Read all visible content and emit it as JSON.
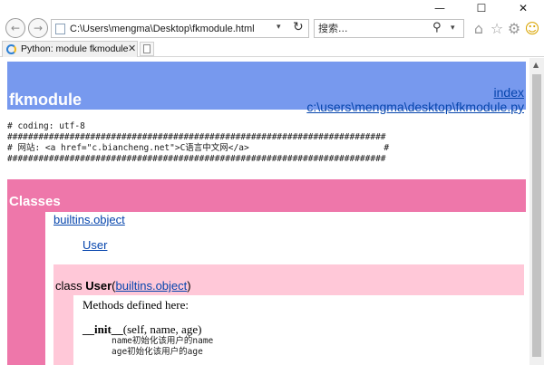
{
  "window": {
    "minimize_glyph": "—",
    "maximize_glyph": "☐",
    "close_glyph": "✕"
  },
  "nav": {
    "back_glyph": "←",
    "forward_glyph": "→",
    "address": "C:\\Users\\mengma\\Desktop\\fkmodule.html",
    "address_dropdown_glyph": "▾",
    "refresh_glyph": "↻",
    "search_placeholder": "搜索...",
    "search_glyph": "⚲",
    "search_dropdown_glyph": "▾",
    "home_glyph": "⌂",
    "favorites_glyph": "☆",
    "tools_glyph": "⚙",
    "smiley_glyph": "☺"
  },
  "tabs": [
    {
      "label": "Python: module fkmodule",
      "close_glyph": "✕"
    }
  ],
  "scrollbar": {
    "up_glyph": "▲"
  },
  "page": {
    "module_name": "fkmodule",
    "index_link": "index",
    "file_link": "c:\\users\\mengma\\desktop\\fkmodule.py",
    "source_lines": [
      "# coding: utf-8",
      "#########################################################################",
      "# 网站: <a href=\"c.biancheng.net\">C语言中文网</a>                          #",
      "#########################################################################"
    ],
    "classes_header": "Classes",
    "builtins_link": "builtins.object",
    "user_link": "User",
    "class_decl": {
      "keyword": "class ",
      "name": "User",
      "open": "(",
      "base": "builtins.object",
      "close": ")"
    },
    "methods_header": "Methods defined here:",
    "init_method": {
      "name": "__init__",
      "args": "(self, name, age)"
    },
    "init_doc": [
      "name初始化该用户的name",
      "age初始化该用户的age"
    ]
  },
  "colors": {
    "heading_bg": "#7799ee",
    "classes_bg": "#ee77aa",
    "class_band_bg": "#ffc8d8",
    "link": "#0645ad"
  }
}
